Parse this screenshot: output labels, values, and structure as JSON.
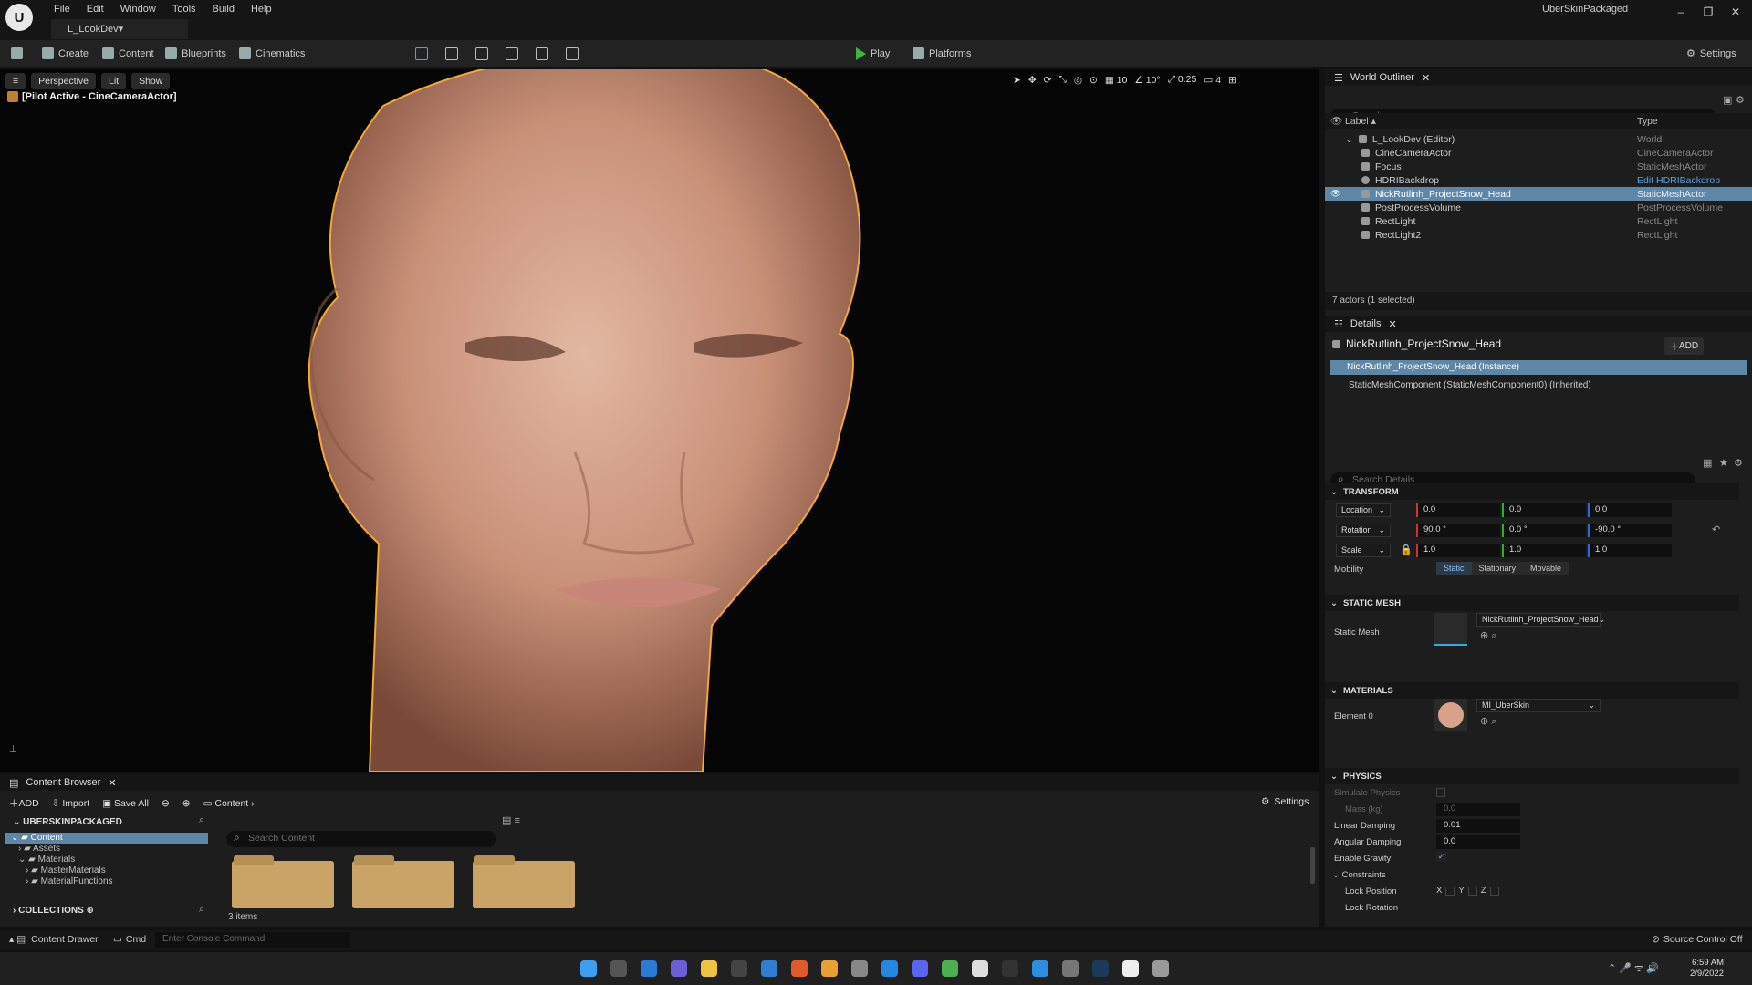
{
  "window": {
    "project_name": "UberSkinPackaged",
    "doc_tab": "L_LookDev",
    "logo": "U",
    "min": "–",
    "max": "❐",
    "close": "✕"
  },
  "menu": [
    "File",
    "Edit",
    "Window",
    "Tools",
    "Build",
    "Help"
  ],
  "toolbar": {
    "create": "Create",
    "content": "Content",
    "blueprints": "Blueprints",
    "cinematics": "Cinematics",
    "play": "Play",
    "platforms": "Platforms",
    "settings": "Settings"
  },
  "viewport": {
    "perspective": "Perspective",
    "lit": "Lit",
    "show": "Show",
    "pilot": "[Pilot Active - CineCameraActor]",
    "grid": "10",
    "angle": "10°",
    "scale": "0.25",
    "cam_speed": "4"
  },
  "outliner": {
    "title": "World Outliner",
    "search_placeholder": "Search...",
    "col_label": "Label",
    "col_type": "Type",
    "rows": [
      {
        "label": "L_LookDev (Editor)",
        "type": "World",
        "indent": 1
      },
      {
        "label": "CineCameraActor",
        "type": "CineCameraActor",
        "indent": 2
      },
      {
        "label": "Focus",
        "type": "StaticMeshActor",
        "indent": 2
      },
      {
        "label": "HDRIBackdrop",
        "type": "Edit HDRIBackdrop",
        "indent": 2
      },
      {
        "label": "NickRutlinh_ProjectSnow_Head",
        "type": "StaticMeshActor",
        "indent": 2,
        "selected": true
      },
      {
        "label": "PostProcessVolume",
        "type": "PostProcessVolume",
        "indent": 2
      },
      {
        "label": "RectLight",
        "type": "RectLight",
        "indent": 2
      },
      {
        "label": "RectLight2",
        "type": "RectLight",
        "indent": 2
      }
    ],
    "footer": "7 actors (1 selected)"
  },
  "details": {
    "title": "Details",
    "actor": "NickRutlinh_ProjectSnow_Head",
    "add": "ADD",
    "instance": "NickRutlinh_ProjectSnow_Head (Instance)",
    "component": "StaticMeshComponent (StaticMeshComponent0) (Inherited)",
    "search_placeholder": "Search Details",
    "transform": {
      "title": "TRANSFORM",
      "location_label": "Location",
      "location": [
        "0.0",
        "0.0",
        "0.0"
      ],
      "rotation_label": "Rotation",
      "rotation": [
        "90.0 °",
        "0.0 °",
        "-90.0 °"
      ],
      "scale_label": "Scale",
      "scale": [
        "1.0",
        "1.0",
        "1.0"
      ],
      "mobility_label": "Mobility",
      "mobility": [
        "Static",
        "Stationary",
        "Movable"
      ]
    },
    "static_mesh": {
      "title": "STATIC MESH",
      "label": "Static Mesh",
      "value": "NickRutlinh_ProjectSnow_Head"
    },
    "materials": {
      "title": "MATERIALS",
      "label": "Element 0",
      "value": "MI_UberSkin"
    },
    "physics": {
      "title": "PHYSICS",
      "simulate": "Simulate Physics",
      "mass_label": "Mass (kg)",
      "mass": "0.0",
      "linear_label": "Linear Damping",
      "linear": "0.01",
      "angular_label": "Angular Damping",
      "angular": "0.0",
      "gravity_label": "Enable Gravity",
      "constraints": "Constraints",
      "lock_pos": "Lock Position",
      "lock_rot": "Lock Rotation",
      "axes": [
        "X",
        "Y",
        "Z"
      ]
    }
  },
  "content_browser": {
    "title": "Content Browser",
    "add": "ADD",
    "import": "Import",
    "save_all": "Save All",
    "path": "Content",
    "settings": "Settings",
    "project": "UBERSKINPACKAGED",
    "tree": [
      {
        "label": "Content",
        "level": 0,
        "selected": true
      },
      {
        "label": "Assets",
        "level": 1
      },
      {
        "label": "Materials",
        "level": 1
      },
      {
        "label": "MasterMaterials",
        "level": 2
      },
      {
        "label": "MaterialFunctions",
        "level": 2
      }
    ],
    "collections": "COLLECTIONS",
    "search_placeholder": "Search Content",
    "item_count": "3 items"
  },
  "status": {
    "content_drawer": "Content Drawer",
    "cmd": "Cmd",
    "console_placeholder": "Enter Console Command",
    "source_control": "Source Control Off"
  },
  "taskbar": {
    "time": "6:59 AM",
    "date": "2/9/2022"
  }
}
